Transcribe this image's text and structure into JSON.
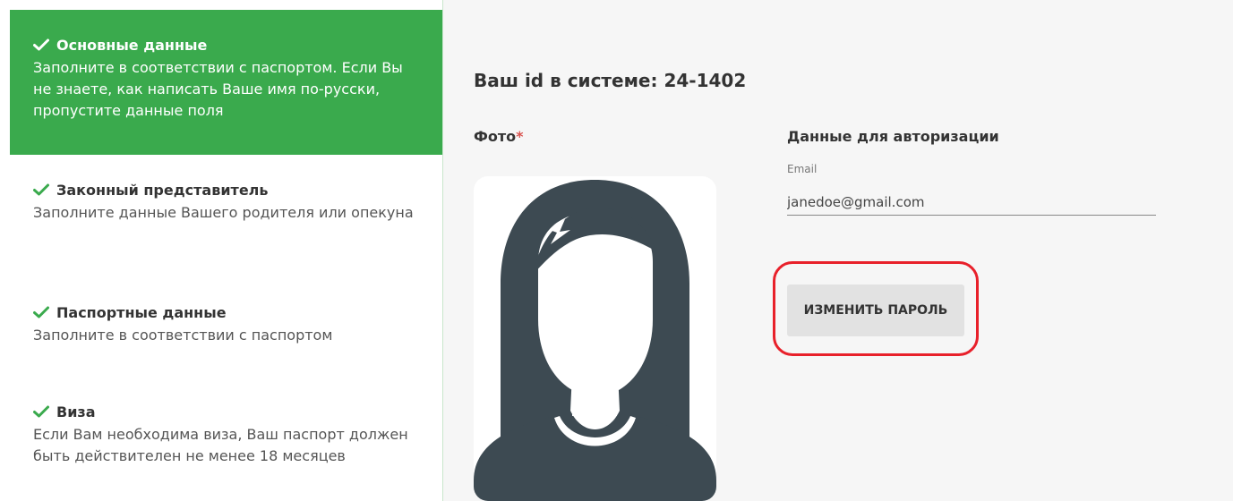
{
  "sidebar": {
    "steps": [
      {
        "title": "Основные данные",
        "description": "Заполните в соответствии с паспортом. Если Вы не знаете, как написать Ваше имя по-русски, пропустите данные поля",
        "active": true
      },
      {
        "title": "Законный представитель",
        "description": "Заполните данные Вашего родителя или опекуна",
        "active": false
      },
      {
        "title": "Паспортные данные",
        "description": "Заполните в соответствии с паспортом",
        "active": false
      },
      {
        "title": "Виза",
        "description": "Если Вам необходима виза, Ваш паспорт должен быть действителен не менее 18 месяцев",
        "active": false
      }
    ]
  },
  "main": {
    "id_label": "Ваш id в системе: 24-1402",
    "photo_label": "Фото",
    "required_mark": "*",
    "auth": {
      "title": "Данные для авторизации",
      "email_label": "Email",
      "email_value": "janedoe@gmail.com",
      "change_password_label": "ИЗМЕНИТЬ ПАРОЛЬ"
    }
  },
  "colors": {
    "accent_green": "#3aaa4d",
    "highlight_red": "#e8202a",
    "avatar_dark": "#3d4a52"
  }
}
